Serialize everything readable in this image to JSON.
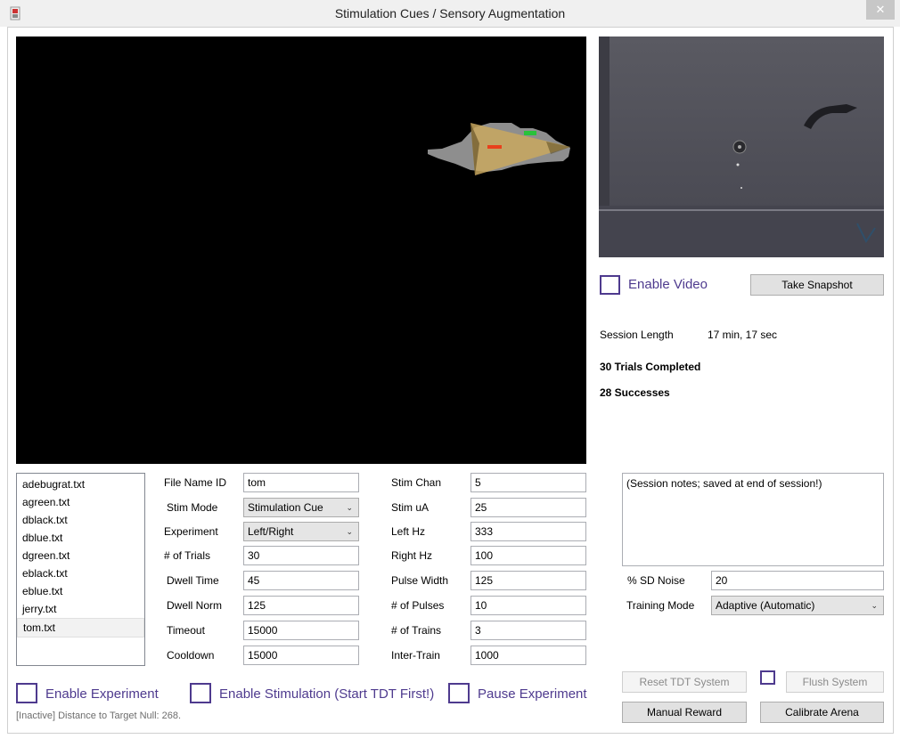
{
  "window": {
    "title": "Stimulation Cues / Sensory Augmentation",
    "close_glyph": "✕"
  },
  "video": {
    "enable_label": "Enable Video",
    "snapshot_label": "Take Snapshot"
  },
  "session": {
    "length_label": "Session Length",
    "length_value": "17 min, 17 sec",
    "trials_completed": "30 Trials Completed",
    "successes": "28 Successes"
  },
  "files": [
    "adebugrat.txt",
    "agreen.txt",
    "dblack.txt",
    "dblue.txt",
    "dgreen.txt",
    "eblack.txt",
    "eblue.txt",
    "jerry.txt",
    "tom.txt"
  ],
  "selected_file": "tom.txt",
  "params_left": {
    "file_name_id": {
      "label": "File Name ID",
      "value": "tom"
    },
    "stim_mode": {
      "label": "Stim Mode",
      "value": "Stimulation Cue"
    },
    "experiment": {
      "label": "Experiment",
      "value": "Left/Right"
    },
    "num_trials": {
      "label": "# of Trials",
      "value": "30"
    },
    "dwell_time": {
      "label": "Dwell Time",
      "value": "45"
    },
    "dwell_norm": {
      "label": "Dwell Norm",
      "value": "125"
    },
    "timeout": {
      "label": "Timeout",
      "value": "15000"
    },
    "cooldown": {
      "label": "Cooldown",
      "value": "15000"
    }
  },
  "params_right": {
    "stim_chan": {
      "label": "Stim Chan",
      "value": "5"
    },
    "stim_ua": {
      "label": "Stim uA",
      "value": "25"
    },
    "left_hz": {
      "label": "Left Hz",
      "value": "333"
    },
    "right_hz": {
      "label": "Right Hz",
      "value": "100"
    },
    "pulse_width": {
      "label": "Pulse Width",
      "value": "125"
    },
    "num_pulses": {
      "label": "# of Pulses",
      "value": "10"
    },
    "num_trains": {
      "label": "# of Trains",
      "value": "3"
    },
    "inter_train": {
      "label": "Inter-Train",
      "value": "1000"
    }
  },
  "notes": {
    "text": "(Session notes; saved at end of session!)"
  },
  "noise": {
    "label": "% SD Noise",
    "value": "20"
  },
  "training": {
    "label": "Training Mode",
    "value": "Adaptive (Automatic)"
  },
  "buttons": {
    "reset_tdt": "Reset TDT System",
    "flush": "Flush System",
    "manual_reward": "Manual Reward",
    "calibrate": "Calibrate Arena"
  },
  "checks": {
    "enable_experiment": "Enable Experiment",
    "enable_stimulation": "Enable Stimulation (Start TDT First!)",
    "pause_experiment": "Pause Experiment"
  },
  "status": "[Inactive] Distance to Target Null: 268.",
  "colors": {
    "accent": "#4e3a8e",
    "tracker_fill": "#c9a85f",
    "tracker_red": "#e8401c",
    "tracker_green": "#29c23a"
  }
}
